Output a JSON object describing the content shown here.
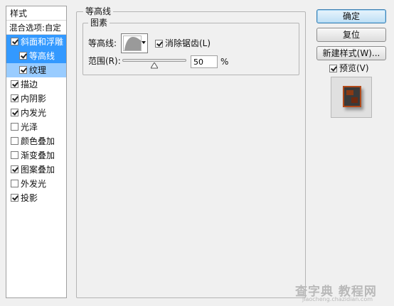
{
  "styles_panel": {
    "title": "样式",
    "blend_options": "混合选项:自定",
    "items": [
      {
        "label": "斜面和浮雕",
        "checked": true
      },
      {
        "label": "等高线",
        "checked": true
      },
      {
        "label": "纹理",
        "checked": true
      },
      {
        "label": "描边",
        "checked": true
      },
      {
        "label": "内阴影",
        "checked": true
      },
      {
        "label": "内发光",
        "checked": true
      },
      {
        "label": "光泽",
        "checked": false
      },
      {
        "label": "颜色叠加",
        "checked": false
      },
      {
        "label": "渐变叠加",
        "checked": false
      },
      {
        "label": "图案叠加",
        "checked": true
      },
      {
        "label": "外发光",
        "checked": false
      },
      {
        "label": "投影",
        "checked": true
      }
    ]
  },
  "contour_section": {
    "group_title": "等高线",
    "subgroup_title": "图素",
    "contour_label": "等高线:",
    "contour_curve": "cone",
    "anti_alias_label": "消除锯齿(L)",
    "anti_alias_checked": true,
    "range_label": "范围(R):",
    "range_value": "50",
    "range_unit": "%",
    "range_level_percent": 50
  },
  "buttons": {
    "ok": "确定",
    "reset": "复位",
    "new_style": "新建样式(W)..."
  },
  "preview": {
    "label": "预览(V)",
    "checked": true
  },
  "watermark": {
    "main": "查字典 教程网",
    "url": "jiaocheng.chazidian.com"
  },
  "colors": {
    "selection": "#3399ff",
    "selection_light": "#99ccff",
    "dialog_bg": "#f0f0f0"
  }
}
